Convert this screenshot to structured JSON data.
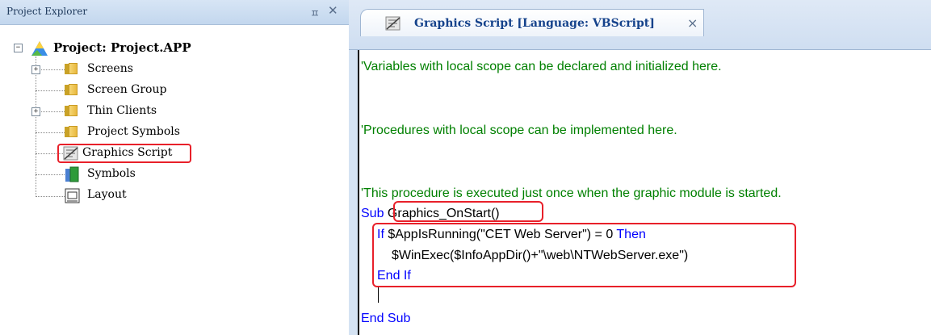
{
  "explorer": {
    "title": "Project Explorer",
    "pin_glyph": "ㅍ",
    "close_glyph": "✕",
    "root_label": "Project: Project.APP",
    "items": [
      {
        "label": "Screens"
      },
      {
        "label": "Screen Group"
      },
      {
        "label": "Thin Clients"
      },
      {
        "label": "Project Symbols"
      },
      {
        "label": "Graphics Script"
      },
      {
        "label": "Symbols"
      },
      {
        "label": "Layout"
      }
    ],
    "expander_collapsed": "+",
    "expander_expanded": "−"
  },
  "editor": {
    "tab_label": "Graphics Script [Language: VBScript]",
    "tab_close_glyph": "×",
    "code": {
      "line1": "'Variables with local scope can be declared and initialized here.",
      "line2": "'Procedures with local scope can be implemented here.",
      "line3": "'This procedure is executed just once when the graphic module is started.",
      "sub_kw": "Sub",
      "sub_name": "Graphics_OnStart()",
      "if_kw": "If",
      "if_expr": " $AppIsRunning(\"CET Web Server\") = 0 ",
      "then_kw": "Then",
      "winexec": "$WinExec($InfoAppDir()+\"\\web\\NTWebServer.exe\")",
      "end_if": "End If",
      "end_sub": "End Sub"
    }
  },
  "colors": {
    "comment": "#008000",
    "keyword": "#0000ff",
    "highlight": "#e8202a"
  }
}
